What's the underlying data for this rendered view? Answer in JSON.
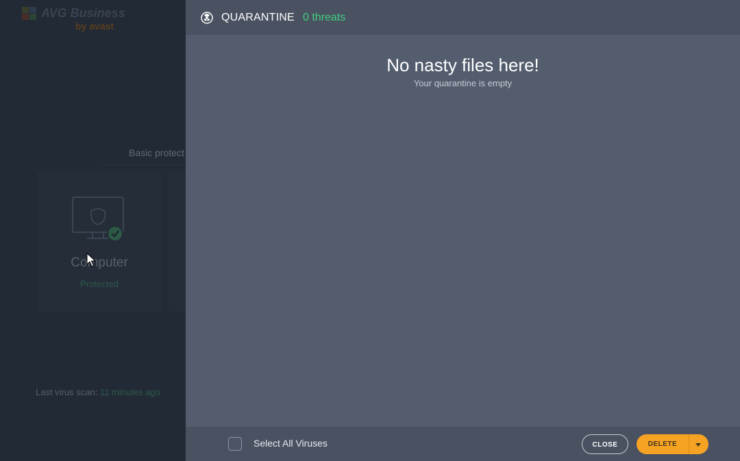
{
  "background_app": {
    "logo": {
      "name": "AVG Business",
      "sub": "by avast"
    },
    "section_label": "Basic protect",
    "tile": {
      "title": "Computer",
      "status": "Protected"
    },
    "scan": {
      "prefix": "Last virus scan:",
      "value": "11 minutes ago"
    }
  },
  "quarantine": {
    "title": "QUARANTINE",
    "count": "0 threats",
    "empty_title": "No nasty files here!",
    "empty_subtitle": "Your quarantine is empty",
    "footer": {
      "select_all_label": "Select All Viruses",
      "close_label": "CLOSE",
      "delete_label": "DELETE"
    }
  },
  "colors": {
    "accent_green": "#3fd07c",
    "delete_orange": "#f6a323",
    "panel_bg": "#545d6e",
    "header_bg": "#4a5262"
  },
  "icons": [
    "biohazard-icon",
    "monitor-shield-icon",
    "check-badge-icon",
    "chevron-down-icon",
    "mouse-cursor"
  ]
}
